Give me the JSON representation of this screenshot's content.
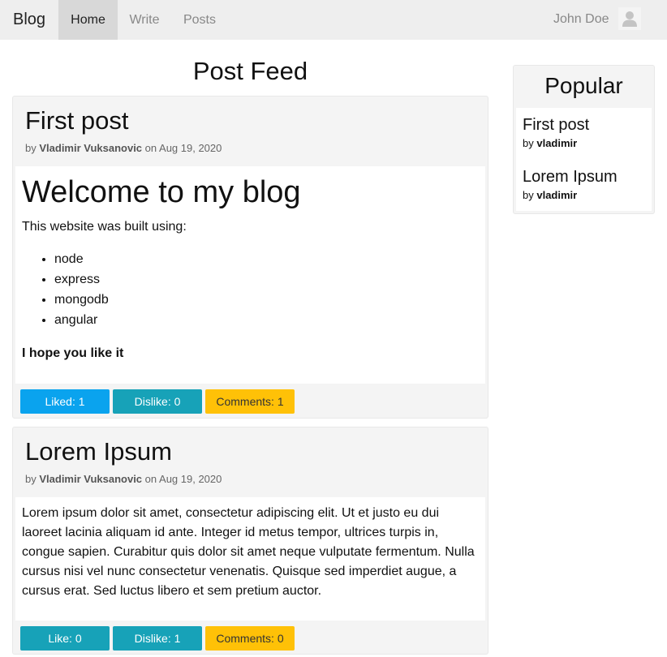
{
  "navbar": {
    "brand": "Blog",
    "items": [
      {
        "label": "Home",
        "active": true
      },
      {
        "label": "Write",
        "active": false
      },
      {
        "label": "Posts",
        "active": false
      }
    ],
    "user_name": "John Doe",
    "avatar_icon": "user-avatar-icon"
  },
  "feed": {
    "title": "Post Feed",
    "posts": [
      {
        "title": "First post",
        "by": "by",
        "author": "Vladimir Vuksanovic",
        "on": "on Aug 19, 2020",
        "content": {
          "heading": "Welcome to my blog",
          "intro": "This website was built using:",
          "list": [
            "node",
            "express",
            "mongodb",
            "angular"
          ],
          "closing": "I hope you like it"
        },
        "like_label": "Liked: 1",
        "dislike_label": "Dislike: 0",
        "comments_label": "Comments: 1"
      },
      {
        "title": "Lorem Ipsum",
        "by": "by",
        "author": "Vladimir Vuksanovic",
        "on": "on Aug 19, 2020",
        "content": {
          "paragraph": "Lorem ipsum dolor sit amet, consectetur adipiscing elit. Ut et justo eu dui laoreet lacinia aliquam id ante. Integer id metus tempor, ultrices turpis in, congue sapien. Curabitur quis dolor sit amet neque vulputate fermentum. Nulla cursus nisi vel nunc consectetur venenatis. Quisque sed imperdiet augue, a cursus erat. Sed luctus libero et sem pretium auctor."
        },
        "like_label": "Like: 0",
        "dislike_label": "Dislike: 1",
        "comments_label": "Comments: 0"
      }
    ]
  },
  "popular": {
    "title": "Popular",
    "items": [
      {
        "title": "First post",
        "by": "by",
        "author": "vladimir"
      },
      {
        "title": "Lorem Ipsum",
        "by": "by",
        "author": "vladimir"
      }
    ]
  },
  "colors": {
    "navbar_bg": "#eeeeee",
    "nav_active_bg": "#d8d8d8",
    "liked_button": "#0aa3ee",
    "like_button": "#17a2b8",
    "dislike_button": "#17a2b8",
    "comments_button": "#ffc107",
    "card_bg": "#f4f4f4"
  }
}
